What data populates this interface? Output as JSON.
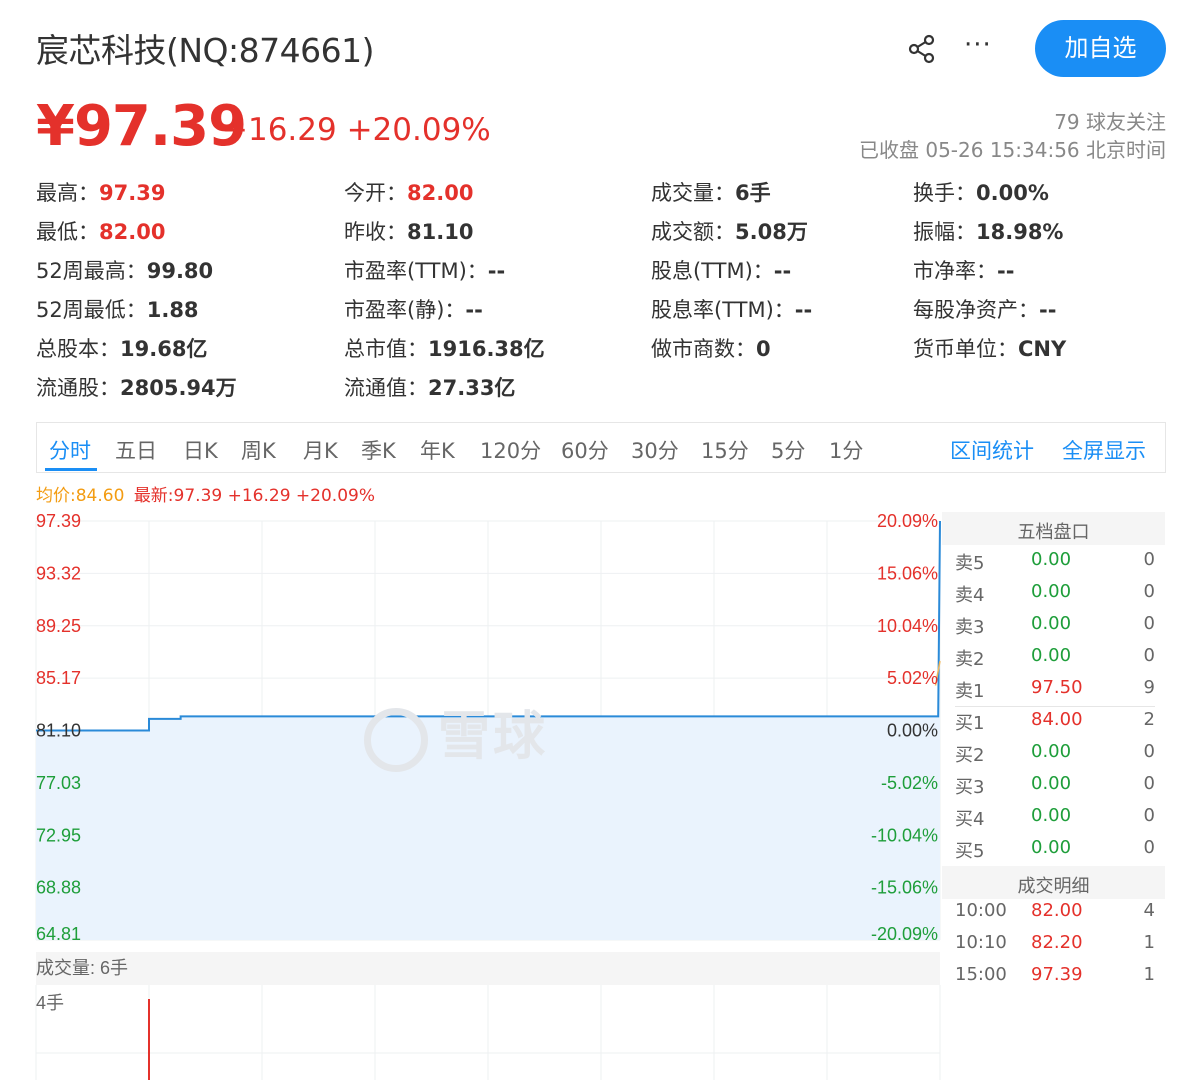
{
  "header": {
    "title": "宸芯科技(NQ:874661)",
    "add_button": "加自选",
    "share_icon": "share-icon",
    "more_icon": "more-icon",
    "more_glyph": "···"
  },
  "quote": {
    "price": "¥97.39",
    "change": "+16.29 +20.09%",
    "followers": "79 球友关注",
    "status": "已收盘 05-26 15:34:56 北京时间"
  },
  "stats": [
    {
      "label": "最高：",
      "value": "97.39",
      "color": "red"
    },
    {
      "label": "今开：",
      "value": "82.00",
      "color": "red"
    },
    {
      "label": "成交量：",
      "value": "6手"
    },
    {
      "label": "换手：",
      "value": "0.00%"
    },
    {
      "label": "最低：",
      "value": "82.00",
      "color": "red"
    },
    {
      "label": "昨收：",
      "value": "81.10"
    },
    {
      "label": "成交额：",
      "value": "5.08万"
    },
    {
      "label": "振幅：",
      "value": "18.98%"
    },
    {
      "label": "52周最高：",
      "value": "99.80"
    },
    {
      "label": "市盈率(TTM)：",
      "value": "--"
    },
    {
      "label": "股息(TTM)：",
      "value": "--"
    },
    {
      "label": "市净率：",
      "value": "--"
    },
    {
      "label": "52周最低：",
      "value": "1.88"
    },
    {
      "label": "市盈率(静)：",
      "value": "--"
    },
    {
      "label": "股息率(TTM)：",
      "value": "--"
    },
    {
      "label": "每股净资产：",
      "value": "--"
    },
    {
      "label": "总股本：",
      "value": "19.68亿"
    },
    {
      "label": "总市值：",
      "value": "1916.38亿"
    },
    {
      "label": "做市商数：",
      "value": "0"
    },
    {
      "label": "货币单位：",
      "value": "CNY"
    },
    {
      "label": "流通股：",
      "value": "2805.94万"
    },
    {
      "label": "流通值：",
      "value": "27.33亿"
    }
  ],
  "tabs": [
    "分时",
    "五日",
    "日K",
    "周K",
    "月K",
    "季K",
    "年K",
    "120分",
    "60分",
    "30分",
    "15分",
    "5分",
    "1分"
  ],
  "tab_right": [
    "区间统计",
    "全屏显示"
  ],
  "chart_info": {
    "avg": "均价:84.60",
    "latest": "最新:97.39 +16.29 +20.09%"
  },
  "chart_data": {
    "type": "line",
    "y_left": [
      "97.39",
      "93.32",
      "89.25",
      "85.17",
      "81.10",
      "77.03",
      "72.95",
      "68.88",
      "64.81"
    ],
    "y_right": [
      "20.09%",
      "15.06%",
      "10.04%",
      "5.02%",
      "0.00%",
      "-5.02%",
      "-10.04%",
      "-15.06%",
      "-20.09%"
    ],
    "ylim": [
      64.81,
      97.39
    ],
    "prev_close": 81.1,
    "series": [
      {
        "values": [
          [
            0,
            81.1
          ],
          [
            0.125,
            81.1
          ],
          [
            0.125,
            82.0
          ],
          [
            0.16,
            82.0
          ],
          [
            0.16,
            82.2
          ],
          [
            0.998,
            82.2
          ],
          [
            1.0,
            97.39
          ]
        ]
      }
    ],
    "volume_label": "成交量: 6手",
    "volume_axis": "4手",
    "volume_bars": [
      {
        "x": 0.125,
        "value": 4
      }
    ]
  },
  "watermark": "雪球",
  "orderbook": {
    "title": "五档盘口",
    "rows": [
      {
        "label": "卖5",
        "price": "0.00",
        "vol": "0",
        "pc": "g"
      },
      {
        "label": "卖4",
        "price": "0.00",
        "vol": "0",
        "pc": "g"
      },
      {
        "label": "卖3",
        "price": "0.00",
        "vol": "0",
        "pc": "g"
      },
      {
        "label": "卖2",
        "price": "0.00",
        "vol": "0",
        "pc": "g"
      },
      {
        "label": "卖1",
        "price": "97.50",
        "vol": "9",
        "pc": "r"
      },
      {
        "label": "买1",
        "price": "84.00",
        "vol": "2",
        "pc": "r"
      },
      {
        "label": "买2",
        "price": "0.00",
        "vol": "0",
        "pc": "g"
      },
      {
        "label": "买3",
        "price": "0.00",
        "vol": "0",
        "pc": "g"
      },
      {
        "label": "买4",
        "price": "0.00",
        "vol": "0",
        "pc": "g"
      },
      {
        "label": "买5",
        "price": "0.00",
        "vol": "0",
        "pc": "g"
      }
    ]
  },
  "trades": {
    "title": "成交明细",
    "rows": [
      {
        "time": "10:00",
        "price": "82.00",
        "vol": "4",
        "vc": "g"
      },
      {
        "time": "10:10",
        "price": "82.20",
        "vol": "1",
        "vc": "g"
      },
      {
        "time": "15:00",
        "price": "97.39",
        "vol": "1",
        "vc": "g"
      }
    ]
  }
}
